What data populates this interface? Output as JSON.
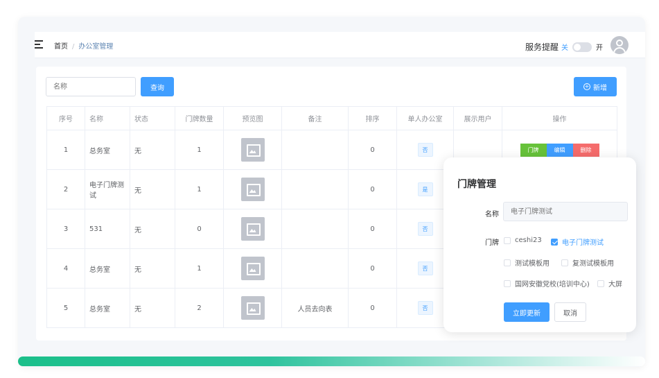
{
  "header": {
    "breadcrumb_home": "首页",
    "breadcrumb_sep": "/",
    "breadcrumb_current": "办公室管理",
    "service_label": "服务提醒",
    "service_off": "关",
    "service_on": "开"
  },
  "toolbar": {
    "search_placeholder": "名称",
    "query_label": "查询",
    "add_label": "新增"
  },
  "table": {
    "columns": [
      "序号",
      "名称",
      "状态",
      "门牌数量",
      "预览图",
      "备注",
      "排序",
      "单人办公室",
      "展示用户",
      "操作"
    ],
    "rows": [
      {
        "index": "1",
        "name": "总务室",
        "status": "无",
        "count": "1",
        "remark": "",
        "sort": "0",
        "single": "否"
      },
      {
        "index": "2",
        "name": "电子门牌测试",
        "status": "无",
        "count": "1",
        "remark": "",
        "sort": "0",
        "single": "是"
      },
      {
        "index": "3",
        "name": "531",
        "status": "无",
        "count": "0",
        "remark": "",
        "sort": "0",
        "single": "否"
      },
      {
        "index": "4",
        "name": "总务室",
        "status": "无",
        "count": "1",
        "remark": "",
        "sort": "0",
        "single": "否"
      },
      {
        "index": "5",
        "name": "总务室",
        "status": "无",
        "count": "2",
        "remark": "人员去向表",
        "sort": "0",
        "single": "否"
      }
    ],
    "ops": {
      "doorplate": "门牌",
      "edit": "编辑",
      "delete": "删除"
    }
  },
  "popup": {
    "title": "门牌管理",
    "name_label": "名称",
    "name_value": "电子门牌测试",
    "door_label": "门牌",
    "options": [
      {
        "label": "ceshi23",
        "checked": false
      },
      {
        "label": "电子门牌测试",
        "checked": true
      },
      {
        "label": "测试模板用",
        "checked": false
      },
      {
        "label": "复测试模板用",
        "checked": false
      },
      {
        "label": "国网安徽党校(培训中心)",
        "checked": false
      },
      {
        "label": "大屏",
        "checked": false
      }
    ],
    "update_label": "立即更新",
    "cancel_label": "取消"
  },
  "colors": {
    "primary": "#409eff",
    "success": "#67c23a",
    "danger": "#f56c6c",
    "gradient_start": "#1bbf8a"
  }
}
